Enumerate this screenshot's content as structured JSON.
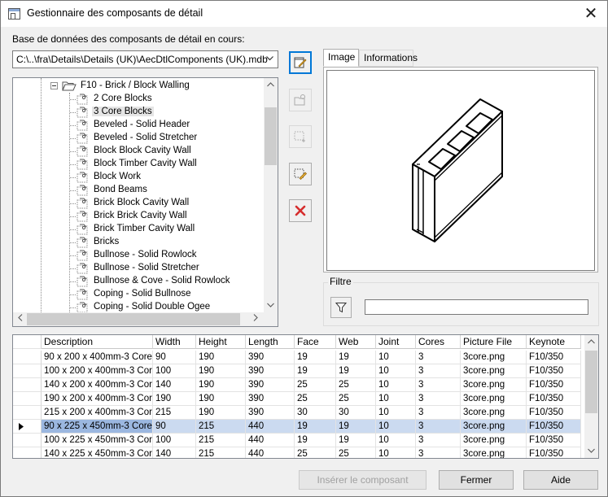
{
  "window": {
    "title": "Gestionnaire des composants de détail",
    "close_label": "✕"
  },
  "database": {
    "label": "Base de données des composants de détail en cours:",
    "path": "C:\\..\\fra\\Details\\Details (UK)\\AecDtlComponents (UK).mdb"
  },
  "tree": {
    "parent": "F10 - Brick / Block Walling",
    "selected_index": 1,
    "items": [
      "2 Core Blocks",
      "3 Core Blocks",
      "Beveled - Solid Header",
      "Beveled - Solid Stretcher",
      "Block Block Cavity Wall",
      "Block Timber Cavity Wall",
      "Block Work",
      "Bond Beams",
      "Brick Block Cavity Wall",
      "Brick Brick Cavity Wall",
      "Brick Timber Cavity Wall",
      "Bricks",
      "Bullnose - Solid Rowlock",
      "Bullnose - Solid Stretcher",
      "Bullnose & Cove - Solid Rowlock",
      "Coping - Solid Bullnose",
      "Coping - Solid Double Ogee"
    ]
  },
  "tabs": [
    "Image",
    "Informations"
  ],
  "active_tab": 0,
  "filter": {
    "label": "Filtre",
    "value": ""
  },
  "table": {
    "columns": [
      "Description",
      "Width",
      "Height",
      "Length",
      "Face",
      "Web",
      "Joint",
      "Cores",
      "Picture File",
      "Keynote"
    ],
    "selected_row": 5,
    "rows": [
      [
        "90 x 200 x 400mm-3 Core",
        "90",
        "190",
        "390",
        "19",
        "19",
        "10",
        "3",
        "3core.png",
        "F10/350"
      ],
      [
        "100 x 200 x 400mm-3 Cor",
        "100",
        "190",
        "390",
        "19",
        "19",
        "10",
        "3",
        "3core.png",
        "F10/350"
      ],
      [
        "140 x 200 x 400mm-3 Cor",
        "140",
        "190",
        "390",
        "25",
        "25",
        "10",
        "3",
        "3core.png",
        "F10/350"
      ],
      [
        "190 x 200 x 400mm-3 Cor",
        "190",
        "190",
        "390",
        "25",
        "25",
        "10",
        "3",
        "3core.png",
        "F10/350"
      ],
      [
        "215 x 200 x 400mm-3 Cor",
        "215",
        "190",
        "390",
        "30",
        "30",
        "10",
        "3",
        "3core.png",
        "F10/350"
      ],
      [
        "90 x 225 x 450mm-3 Core",
        "90",
        "215",
        "440",
        "19",
        "19",
        "10",
        "3",
        "3core.png",
        "F10/350"
      ],
      [
        "100 x 225 x 450mm-3 Cor",
        "100",
        "215",
        "440",
        "19",
        "19",
        "10",
        "3",
        "3core.png",
        "F10/350"
      ],
      [
        "140 x 225 x 450mm-3 Cor",
        "140",
        "215",
        "440",
        "25",
        "25",
        "10",
        "3",
        "3core.png",
        "F10/350"
      ]
    ]
  },
  "buttons": {
    "insert": "Insérer le composant",
    "close": "Fermer",
    "help": "Aide"
  }
}
